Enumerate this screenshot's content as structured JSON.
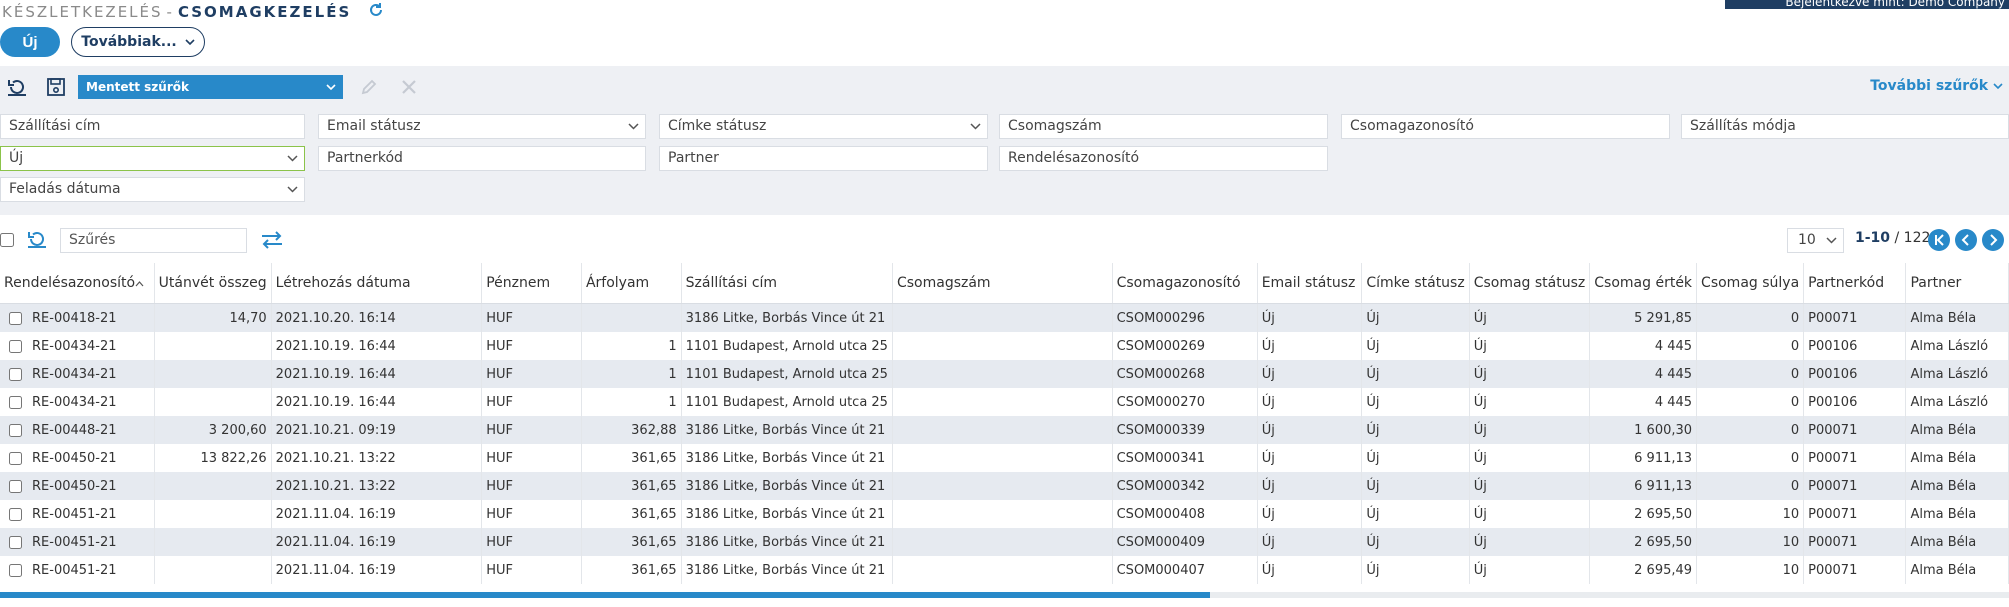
{
  "header": {
    "banner": "Bejelentkezve mint: Demo Company",
    "breadcrumb_root": "KÉSZLETKEZELÉS",
    "breadcrumb_sep": "-",
    "breadcrumb_current": "CSOMAGKEZELÉS"
  },
  "actions": {
    "new_label": "Új",
    "more_label": "Továbbiak..."
  },
  "filter_toolbar": {
    "saved_filters_label": "Mentett szűrők",
    "more_filters_label": "További szűrők"
  },
  "filters": {
    "shipping_address": "Szállítási cím",
    "email_status": "Email státusz",
    "label_status": "Címke státusz",
    "package_number": "Csomagszám",
    "package_id": "Csomagazonosító",
    "shipping_method": "Szállítás módja",
    "status_value": "Új",
    "partner_code": "Partnerkód",
    "partner": "Partner",
    "order_id": "Rendelésazonosító",
    "ship_date": "Feladás dátuma"
  },
  "grid_toolbar": {
    "filter_placeholder": "Szűrés",
    "page_size": "10",
    "range": "1-10",
    "total": "/ 122"
  },
  "colors": {
    "accent": "#2889c9",
    "navy": "#1f3e63",
    "panel": "#eef0f4",
    "row_alt": "#e6eaf0"
  },
  "columns": [
    "Rendelésazonosító",
    "Utánvét összeg",
    "Létrehozás dátuma",
    "Pénznem",
    "Árfolyam",
    "Szállítási cím",
    "Csomagszám",
    "Csomagazonosító",
    "Email státusz",
    "Címke státusz",
    "Csomag státusz",
    "Csomag érték",
    "Csomag súlya",
    "Partnerkód",
    "Partner"
  ],
  "rows": [
    [
      "RE-00418-21",
      "14,70",
      "2021.10.20. 16:14",
      "HUF",
      "",
      "3186 Litke, Borbás Vince út 21",
      "",
      "CSOM000296",
      "Új",
      "Új",
      "Új",
      "5 291,85",
      "0",
      "P00071",
      "Alma Béla"
    ],
    [
      "RE-00434-21",
      "",
      "2021.10.19. 16:44",
      "HUF",
      "1",
      "1101 Budapest, Arnold utca 25",
      "",
      "CSOM000269",
      "Új",
      "Új",
      "Új",
      "4 445",
      "0",
      "P00106",
      "Alma László"
    ],
    [
      "RE-00434-21",
      "",
      "2021.10.19. 16:44",
      "HUF",
      "1",
      "1101 Budapest, Arnold utca 25",
      "",
      "CSOM000268",
      "Új",
      "Új",
      "Új",
      "4 445",
      "0",
      "P00106",
      "Alma László"
    ],
    [
      "RE-00434-21",
      "",
      "2021.10.19. 16:44",
      "HUF",
      "1",
      "1101 Budapest, Arnold utca 25",
      "",
      "CSOM000270",
      "Új",
      "Új",
      "Új",
      "4 445",
      "0",
      "P00106",
      "Alma László"
    ],
    [
      "RE-00448-21",
      "3 200,60",
      "2021.10.21. 09:19",
      "HUF",
      "362,88",
      "3186 Litke, Borbás Vince út 21",
      "",
      "CSOM000339",
      "Új",
      "Új",
      "Új",
      "1 600,30",
      "0",
      "P00071",
      "Alma Béla"
    ],
    [
      "RE-00450-21",
      "13 822,26",
      "2021.10.21. 13:22",
      "HUF",
      "361,65",
      "3186 Litke, Borbás Vince út 21",
      "",
      "CSOM000341",
      "Új",
      "Új",
      "Új",
      "6 911,13",
      "0",
      "P00071",
      "Alma Béla"
    ],
    [
      "RE-00450-21",
      "",
      "2021.10.21. 13:22",
      "HUF",
      "361,65",
      "3186 Litke, Borbás Vince út 21",
      "",
      "CSOM000342",
      "Új",
      "Új",
      "Új",
      "6 911,13",
      "0",
      "P00071",
      "Alma Béla"
    ],
    [
      "RE-00451-21",
      "",
      "2021.11.04. 16:19",
      "HUF",
      "361,65",
      "3186 Litke, Borbás Vince út 21",
      "",
      "CSOM000408",
      "Új",
      "Új",
      "Új",
      "2 695,50",
      "10",
      "P00071",
      "Alma Béla"
    ],
    [
      "RE-00451-21",
      "",
      "2021.11.04. 16:19",
      "HUF",
      "361,65",
      "3186 Litke, Borbás Vince út 21",
      "",
      "CSOM000409",
      "Új",
      "Új",
      "Új",
      "2 695,50",
      "10",
      "P00071",
      "Alma Béla"
    ],
    [
      "RE-00451-21",
      "",
      "2021.11.04. 16:19",
      "HUF",
      "361,65",
      "3186 Litke, Borbás Vince út 21",
      "",
      "CSOM000407",
      "Új",
      "Új",
      "Új",
      "2 695,49",
      "10",
      "P00071",
      "Alma Béla"
    ]
  ]
}
